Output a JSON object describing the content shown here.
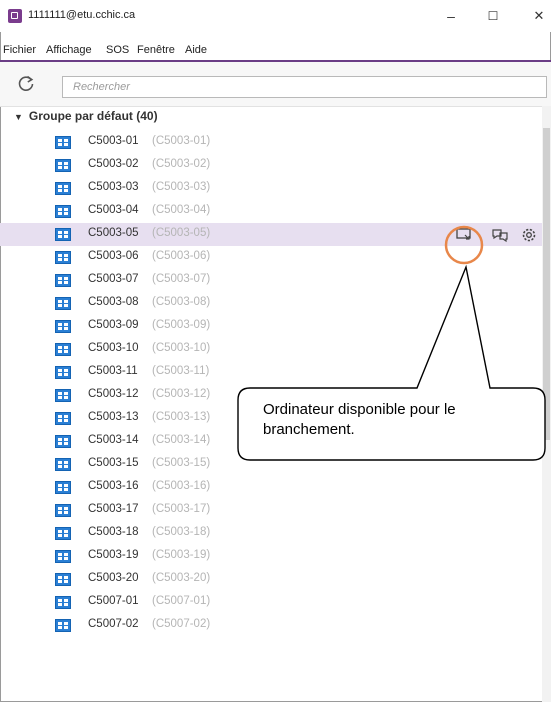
{
  "window": {
    "title": "1111111@etu.cchic.ca",
    "minimize_glyph": "–",
    "maximize_glyph": "☐",
    "close_glyph": "✕"
  },
  "menu": [
    {
      "label": "Fichier"
    },
    {
      "label": "Affichage"
    },
    {
      "label": "SOS"
    },
    {
      "label": "Fenêtre"
    },
    {
      "label": "Aide"
    }
  ],
  "search": {
    "placeholder": "Rechercher",
    "value": ""
  },
  "group": {
    "label": "Groupe par défaut (40)",
    "expanded": true
  },
  "computers": [
    {
      "name": "C5003-01",
      "id": "(C5003-01)"
    },
    {
      "name": "C5003-02",
      "id": "(C5003-02)"
    },
    {
      "name": "C5003-03",
      "id": "(C5003-03)"
    },
    {
      "name": "C5003-04",
      "id": "(C5003-04)"
    },
    {
      "name": "C5003-05",
      "id": "(C5003-05)",
      "selected": true
    },
    {
      "name": "C5003-06",
      "id": "(C5003-06)"
    },
    {
      "name": "C5003-07",
      "id": "(C5003-07)"
    },
    {
      "name": "C5003-08",
      "id": "(C5003-08)"
    },
    {
      "name": "C5003-09",
      "id": "(C5003-09)"
    },
    {
      "name": "C5003-10",
      "id": "(C5003-10)"
    },
    {
      "name": "C5003-11",
      "id": "(C5003-11)"
    },
    {
      "name": "C5003-12",
      "id": "(C5003-12)"
    },
    {
      "name": "C5003-13",
      "id": "(C5003-13)"
    },
    {
      "name": "C5003-14",
      "id": "(C5003-14)"
    },
    {
      "name": "C5003-15",
      "id": "(C5003-15)"
    },
    {
      "name": "C5003-16",
      "id": "(C5003-16)"
    },
    {
      "name": "C5003-17",
      "id": "(C5003-17)"
    },
    {
      "name": "C5003-18",
      "id": "(C5003-18)"
    },
    {
      "name": "C5003-19",
      "id": "(C5003-19)"
    },
    {
      "name": "C5003-20",
      "id": "(C5003-20)"
    },
    {
      "name": "C5007-01",
      "id": "(C5007-01)"
    },
    {
      "name": "C5007-02",
      "id": "(C5007-02)"
    }
  ],
  "selected_row_actions": [
    "remote-connect-icon",
    "chat-icon",
    "settings-gear-icon"
  ],
  "callout": {
    "text": "Ordinateur disponible pour le branchement."
  },
  "colors": {
    "accent": "#6b3d86",
    "selected_row": "#e7dff0",
    "highlight_circle": "#e8874a",
    "pc_icon": "#2a7fd4"
  }
}
